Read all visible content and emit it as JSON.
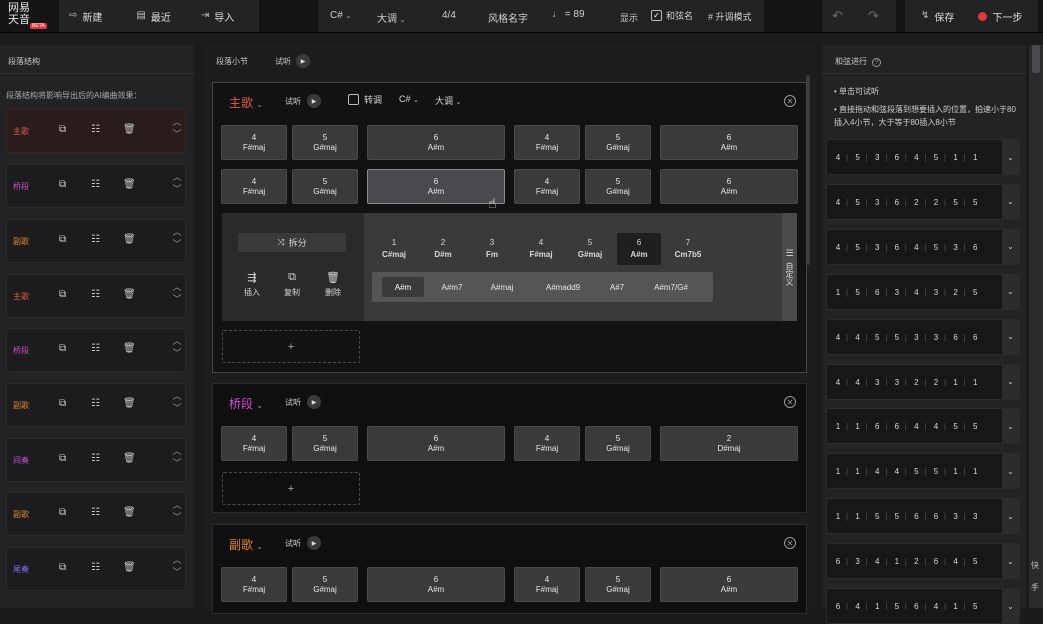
{
  "logo": {
    "line1": "网易",
    "line2": "天音",
    "badge": "BETA"
  },
  "toolbar": {
    "new_label": "新建",
    "recent_label": "最近",
    "import_label": "导入",
    "key": "C#",
    "mode": "大调",
    "time_sig": "4/4",
    "style": "风格名字",
    "tempo": "89",
    "display_label": "显示",
    "chord_name_label": "和弦名",
    "sharp_mode_label": "升调模式",
    "save_label": "保存",
    "next_label": "下一步"
  },
  "left_panel": {
    "title": "段落结构",
    "hint": "段落结构将影响导出后的AI编曲效果：",
    "sections": [
      {
        "label": "主歌",
        "color": "#e05a4a",
        "selected": true
      },
      {
        "label": "桥段",
        "color": "#d04fd0"
      },
      {
        "label": "副歌",
        "color": "#e0832c"
      },
      {
        "label": "主歌",
        "color": "#e05a4a"
      },
      {
        "label": "桥段",
        "color": "#d04fd0"
      },
      {
        "label": "副歌",
        "color": "#e0832c"
      },
      {
        "label": "间奏",
        "color": "#c24fd6"
      },
      {
        "label": "副歌",
        "color": "#e0832c"
      },
      {
        "label": "尾奏",
        "color": "#8b6bf0"
      }
    ]
  },
  "middle_panel": {
    "title": "段落小节",
    "listen_label": "试听"
  },
  "sections": [
    {
      "name": "主歌",
      "color": "#e05a4a",
      "listen": "试听",
      "modulate_label": "转调",
      "key": "C#",
      "mode": "大调",
      "rows": [
        [
          {
            "deg": "4",
            "name": "F#maj"
          },
          {
            "deg": "5",
            "name": "G#maj"
          },
          {
            "deg": "6",
            "name": "A#m"
          },
          {
            "deg": "4",
            "name": "F#maj"
          },
          {
            "deg": "5",
            "name": "G#maj"
          },
          {
            "deg": "6",
            "name": "A#m"
          }
        ],
        [
          {
            "deg": "4",
            "name": "F#maj"
          },
          {
            "deg": "5",
            "name": "G#maj"
          },
          {
            "deg": "6",
            "name": "A#m"
          },
          {
            "deg": "4",
            "name": "F#maj"
          },
          {
            "deg": "5",
            "name": "G#maj"
          },
          {
            "deg": "6",
            "name": "A#m"
          }
        ]
      ]
    },
    {
      "name": "桥段",
      "color": "#d04fd0",
      "listen": "试听",
      "rows": [
        [
          {
            "deg": "4",
            "name": "F#maj"
          },
          {
            "deg": "5",
            "name": "G#maj"
          },
          {
            "deg": "6",
            "name": "A#m"
          },
          {
            "deg": "4",
            "name": "F#maj"
          },
          {
            "deg": "5",
            "name": "G#maj"
          },
          {
            "deg": "2",
            "name": "D#maj"
          }
        ]
      ]
    },
    {
      "name": "副歌",
      "color": "#e0832c",
      "listen": "试听",
      "rows": [
        [
          {
            "deg": "4",
            "name": "F#maj"
          },
          {
            "deg": "5",
            "name": "G#maj"
          },
          {
            "deg": "6",
            "name": "A#m"
          },
          {
            "deg": "4",
            "name": "F#maj"
          },
          {
            "deg": "5",
            "name": "G#maj"
          },
          {
            "deg": "6",
            "name": "A#m"
          }
        ]
      ]
    }
  ],
  "editor": {
    "split_label": "拆分",
    "insert_label": "插入",
    "copy_label": "复制",
    "delete_label": "删除",
    "custom_label": "自定义",
    "degrees": [
      {
        "deg": "1",
        "name": "C#maj"
      },
      {
        "deg": "2",
        "name": "D#m"
      },
      {
        "deg": "3",
        "name": "Fm"
      },
      {
        "deg": "4",
        "name": "F#maj"
      },
      {
        "deg": "5",
        "name": "G#maj"
      },
      {
        "deg": "6",
        "name": "A#m"
      },
      {
        "deg": "7",
        "name": "Cm7b5"
      }
    ],
    "variants": [
      "A#m",
      "A#m7",
      "A#maj",
      "A#madd9",
      "A#7",
      "A#m7/G#"
    ]
  },
  "right_panel": {
    "title": "和弦进行",
    "tip1": "单击可试听",
    "tip2": "直接拖动和弦段落到想要插入的位置，拍速小于80插入4小节，大于等于80插入8小节",
    "progressions": [
      [
        "4",
        "5",
        "3",
        "6",
        "4",
        "5",
        "1",
        "1"
      ],
      [
        "4",
        "5",
        "3",
        "6",
        "2",
        "2",
        "5",
        "5"
      ],
      [
        "4",
        "5",
        "3",
        "6",
        "4",
        "5",
        "3",
        "6"
      ],
      [
        "1",
        "5",
        "6",
        "3",
        "4",
        "3",
        "2",
        "5"
      ],
      [
        "4",
        "4",
        "5",
        "5",
        "3",
        "3",
        "6",
        "6"
      ],
      [
        "4",
        "4",
        "3",
        "3",
        "2",
        "2",
        "1",
        "1"
      ],
      [
        "1",
        "1",
        "6",
        "6",
        "4",
        "4",
        "5",
        "5"
      ],
      [
        "1",
        "1",
        "4",
        "4",
        "5",
        "5",
        "1",
        "1"
      ],
      [
        "1",
        "1",
        "5",
        "5",
        "6",
        "6",
        "3",
        "3"
      ],
      [
        "6",
        "3",
        "4",
        "1",
        "2",
        "6",
        "4",
        "5"
      ],
      [
        "6",
        "4",
        "1",
        "5",
        "6",
        "4",
        "1",
        "5"
      ]
    ]
  },
  "edge_labels": {
    "a": "快",
    "b": "手"
  }
}
